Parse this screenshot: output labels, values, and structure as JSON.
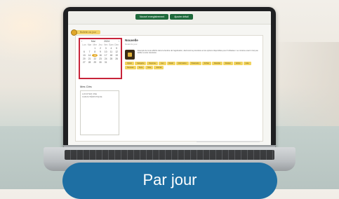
{
  "app": {
    "top_buttons": [
      "Nouvel enregistrement",
      "Ajouter détail"
    ],
    "breadcrumb": "Bulletin du jour"
  },
  "calendar": {
    "prev": "‹",
    "month": "Mai",
    "year": "2024",
    "next": "›",
    "dow": [
      "Lun",
      "Mar",
      "Mer",
      "Jeu",
      "Ven",
      "Sam",
      "Dim"
    ],
    "days": [
      "",
      "",
      "1",
      "2",
      "3",
      "4",
      "5",
      "6",
      "7",
      "8",
      "9",
      "10",
      "11",
      "12",
      "13",
      "14",
      "15",
      "16",
      "17",
      "18",
      "19",
      "20",
      "21",
      "22",
      "23",
      "24",
      "25",
      "26",
      "27",
      "28",
      "29",
      "30",
      "31",
      "",
      ""
    ],
    "selected_day": "15"
  },
  "notes": {
    "title": "Mes Clés",
    "placeholder": "AJOUTER UNE CARACTÉRISTIQUE"
  },
  "content": {
    "title": "Nouvelle",
    "subtitle": "Détail du jour",
    "paragraph": "Exemple de texte affiché dans la fenêtre de l'application, décrivant la procédure et les options disponibles pour l'utilisateur. Le contenu exact n'est pas lisible à cette résolution.",
    "tags": [
      "Option",
      "Catégorie",
      "Réponse",
      "Lien",
      "Détail",
      "Information",
      "Paramètre",
      "Fichier",
      "Résultat",
      "Dossier",
      "Action",
      "Liste",
      "Nouveau",
      "Texte",
      "Note",
      "Journal"
    ]
  },
  "cta": {
    "label": "Par jour",
    "color": "#1e6fa3"
  }
}
